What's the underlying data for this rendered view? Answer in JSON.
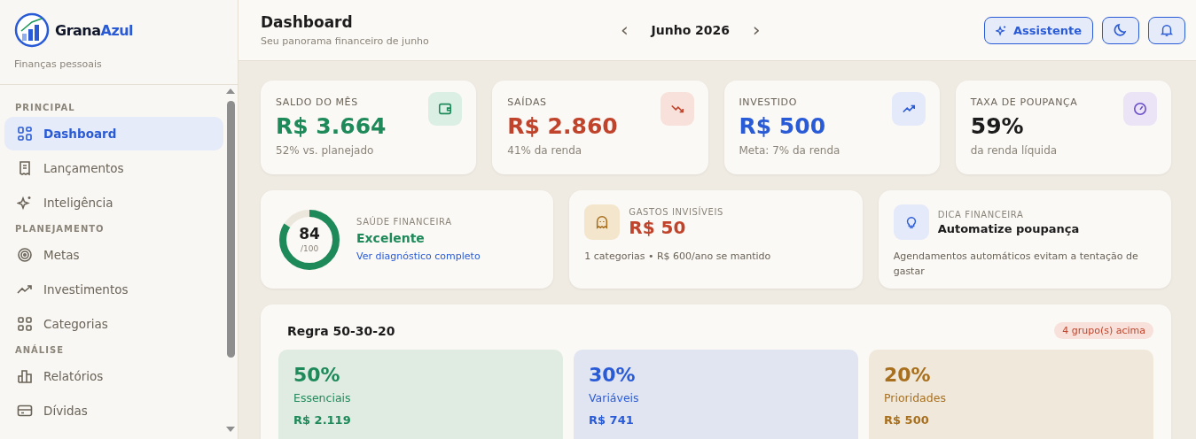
{
  "brand": {
    "name_part_1": "Grana",
    "name_part_2": "Azul",
    "tagline": "Finanças pessoais"
  },
  "sidebar": {
    "sections": [
      {
        "label": "PRINCIPAL",
        "items": [
          {
            "label": "Dashboard",
            "kind": "grid",
            "selected": true
          },
          {
            "label": "Lançamentos",
            "kind": "receipt",
            "selected": false
          },
          {
            "label": "Inteligência",
            "kind": "sparkle",
            "selected": false
          }
        ]
      },
      {
        "label": "PLANEJAMENTO",
        "items": [
          {
            "label": "Metas",
            "kind": "target",
            "selected": false
          },
          {
            "label": "Investimentos",
            "kind": "trend",
            "selected": false
          },
          {
            "label": "Categorias",
            "kind": "squares",
            "selected": false
          }
        ]
      },
      {
        "label": "ANÁLISE",
        "items": [
          {
            "label": "Relatórios",
            "kind": "bars",
            "selected": false
          },
          {
            "label": "Dívidas",
            "kind": "card",
            "selected": false
          }
        ]
      }
    ]
  },
  "header": {
    "title": "Dashboard",
    "subtitle": "Seu panorama financeiro de junho",
    "prev": "‹",
    "month": "Junho 2026",
    "next": "›",
    "assistant_button": "Assistente"
  },
  "stats": [
    {
      "label": "SALDO DO MÊS",
      "value": "R$ 3.664",
      "note": "52% vs. planejado",
      "kind": "wallet",
      "color": "#1e8a5a"
    },
    {
      "label": "SAÍDAS",
      "value": "R$ 2.860",
      "note": "41% da renda",
      "kind": "down",
      "color": "#c0442c"
    },
    {
      "label": "INVESTIDO",
      "value": "R$ 500",
      "note": "Meta: 7% da renda",
      "kind": "up",
      "color": "#2a5bd7"
    },
    {
      "label": "TAXA DE POUPANÇA",
      "value": "59%",
      "note": "da renda líquida",
      "kind": "gauge",
      "color": "#1c1c1c"
    }
  ],
  "health": {
    "score": "84",
    "max": "/100",
    "label": "SAÚDE FINANCEIRA",
    "status": "Excelente",
    "link": "Ver diagnóstico completo"
  },
  "invisible": {
    "label": "GASTOS INVISÍVEIS",
    "value": "R$ 50",
    "note": "1 categorias • R$ 600/ano se mantido"
  },
  "tip": {
    "label": "DICA FINANCEIRA",
    "title": "Automatize poupança",
    "text": "Agendamentos automáticos evitam a tentação de gastar"
  },
  "rule": {
    "title": "Regra 50-30-20",
    "badge": "4 grupo(s) acima",
    "groups": [
      {
        "percent": "50%",
        "name": "Essenciais",
        "amount": "R$ 2.119",
        "color": "#1e8a5a"
      },
      {
        "percent": "30%",
        "name": "Variáveis",
        "amount": "R$ 741",
        "color": "#2a5bd7"
      },
      {
        "percent": "20%",
        "name": "Prioridades",
        "amount": "R$ 500",
        "color": "#a8701e"
      }
    ]
  }
}
